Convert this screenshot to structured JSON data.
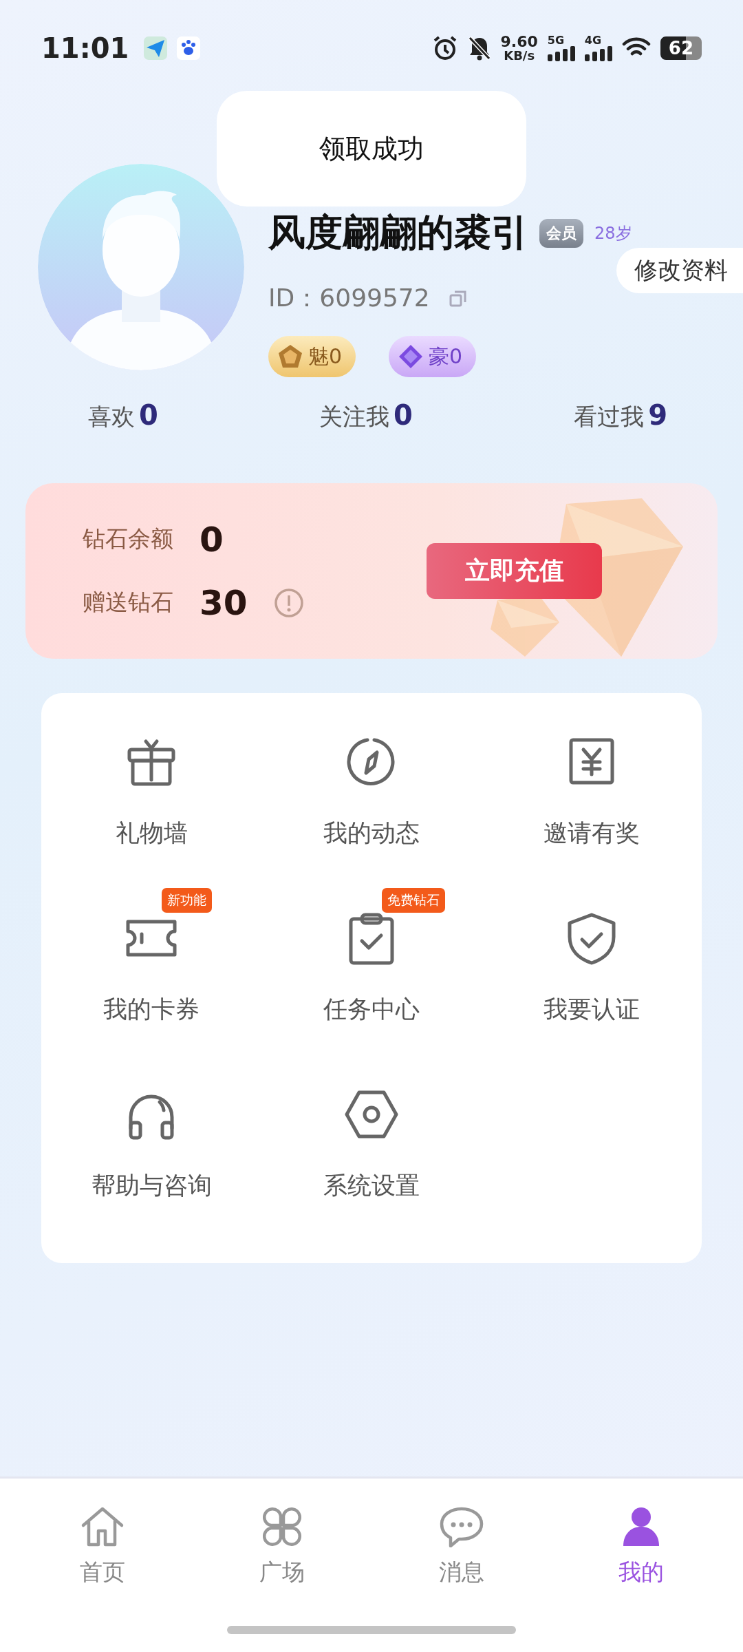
{
  "status_bar": {
    "time": "11:01",
    "speed": "9.60",
    "speed_unit": "KB/s",
    "networks": [
      "5G",
      "4G"
    ],
    "battery": "62"
  },
  "toast": "领取成功",
  "profile": {
    "name": "风度翩翩的裘引",
    "badge": "会员",
    "age": "28岁",
    "id_label": "ID：",
    "id": "6099572",
    "edit_button": "修改资料",
    "chips": [
      {
        "kind": "charm",
        "label": "魅0"
      },
      {
        "kind": "wealth",
        "label": "豪0"
      }
    ]
  },
  "stats": [
    {
      "label": "喜欢",
      "value": "0"
    },
    {
      "label": "关注我",
      "value": "0"
    },
    {
      "label": "看过我",
      "value": "9"
    }
  ],
  "wallet": {
    "rows": [
      {
        "label": "钻石余额",
        "value": "0",
        "info": false
      },
      {
        "label": "赠送钻石",
        "value": "30",
        "info": true
      }
    ],
    "button": "立即充值"
  },
  "menu": [
    {
      "kind": "gift",
      "label": "礼物墙"
    },
    {
      "kind": "compass",
      "label": "我的动态"
    },
    {
      "kind": "yuan",
      "label": "邀请有奖"
    },
    {
      "kind": "ticket",
      "label": "我的卡券",
      "badge": "新功能"
    },
    {
      "kind": "clipboard",
      "label": "任务中心",
      "badge": "免费钻石"
    },
    {
      "kind": "shield",
      "label": "我要认证"
    },
    {
      "kind": "headset",
      "label": "帮助与咨询"
    },
    {
      "kind": "hexagon",
      "label": "系统设置"
    }
  ],
  "nav": [
    {
      "kind": "home",
      "label": "首页",
      "selected": false
    },
    {
      "kind": "clover",
      "label": "广场",
      "selected": false
    },
    {
      "kind": "chat",
      "label": "消息",
      "selected": false
    },
    {
      "kind": "person",
      "label": "我的",
      "selected": true
    }
  ]
}
